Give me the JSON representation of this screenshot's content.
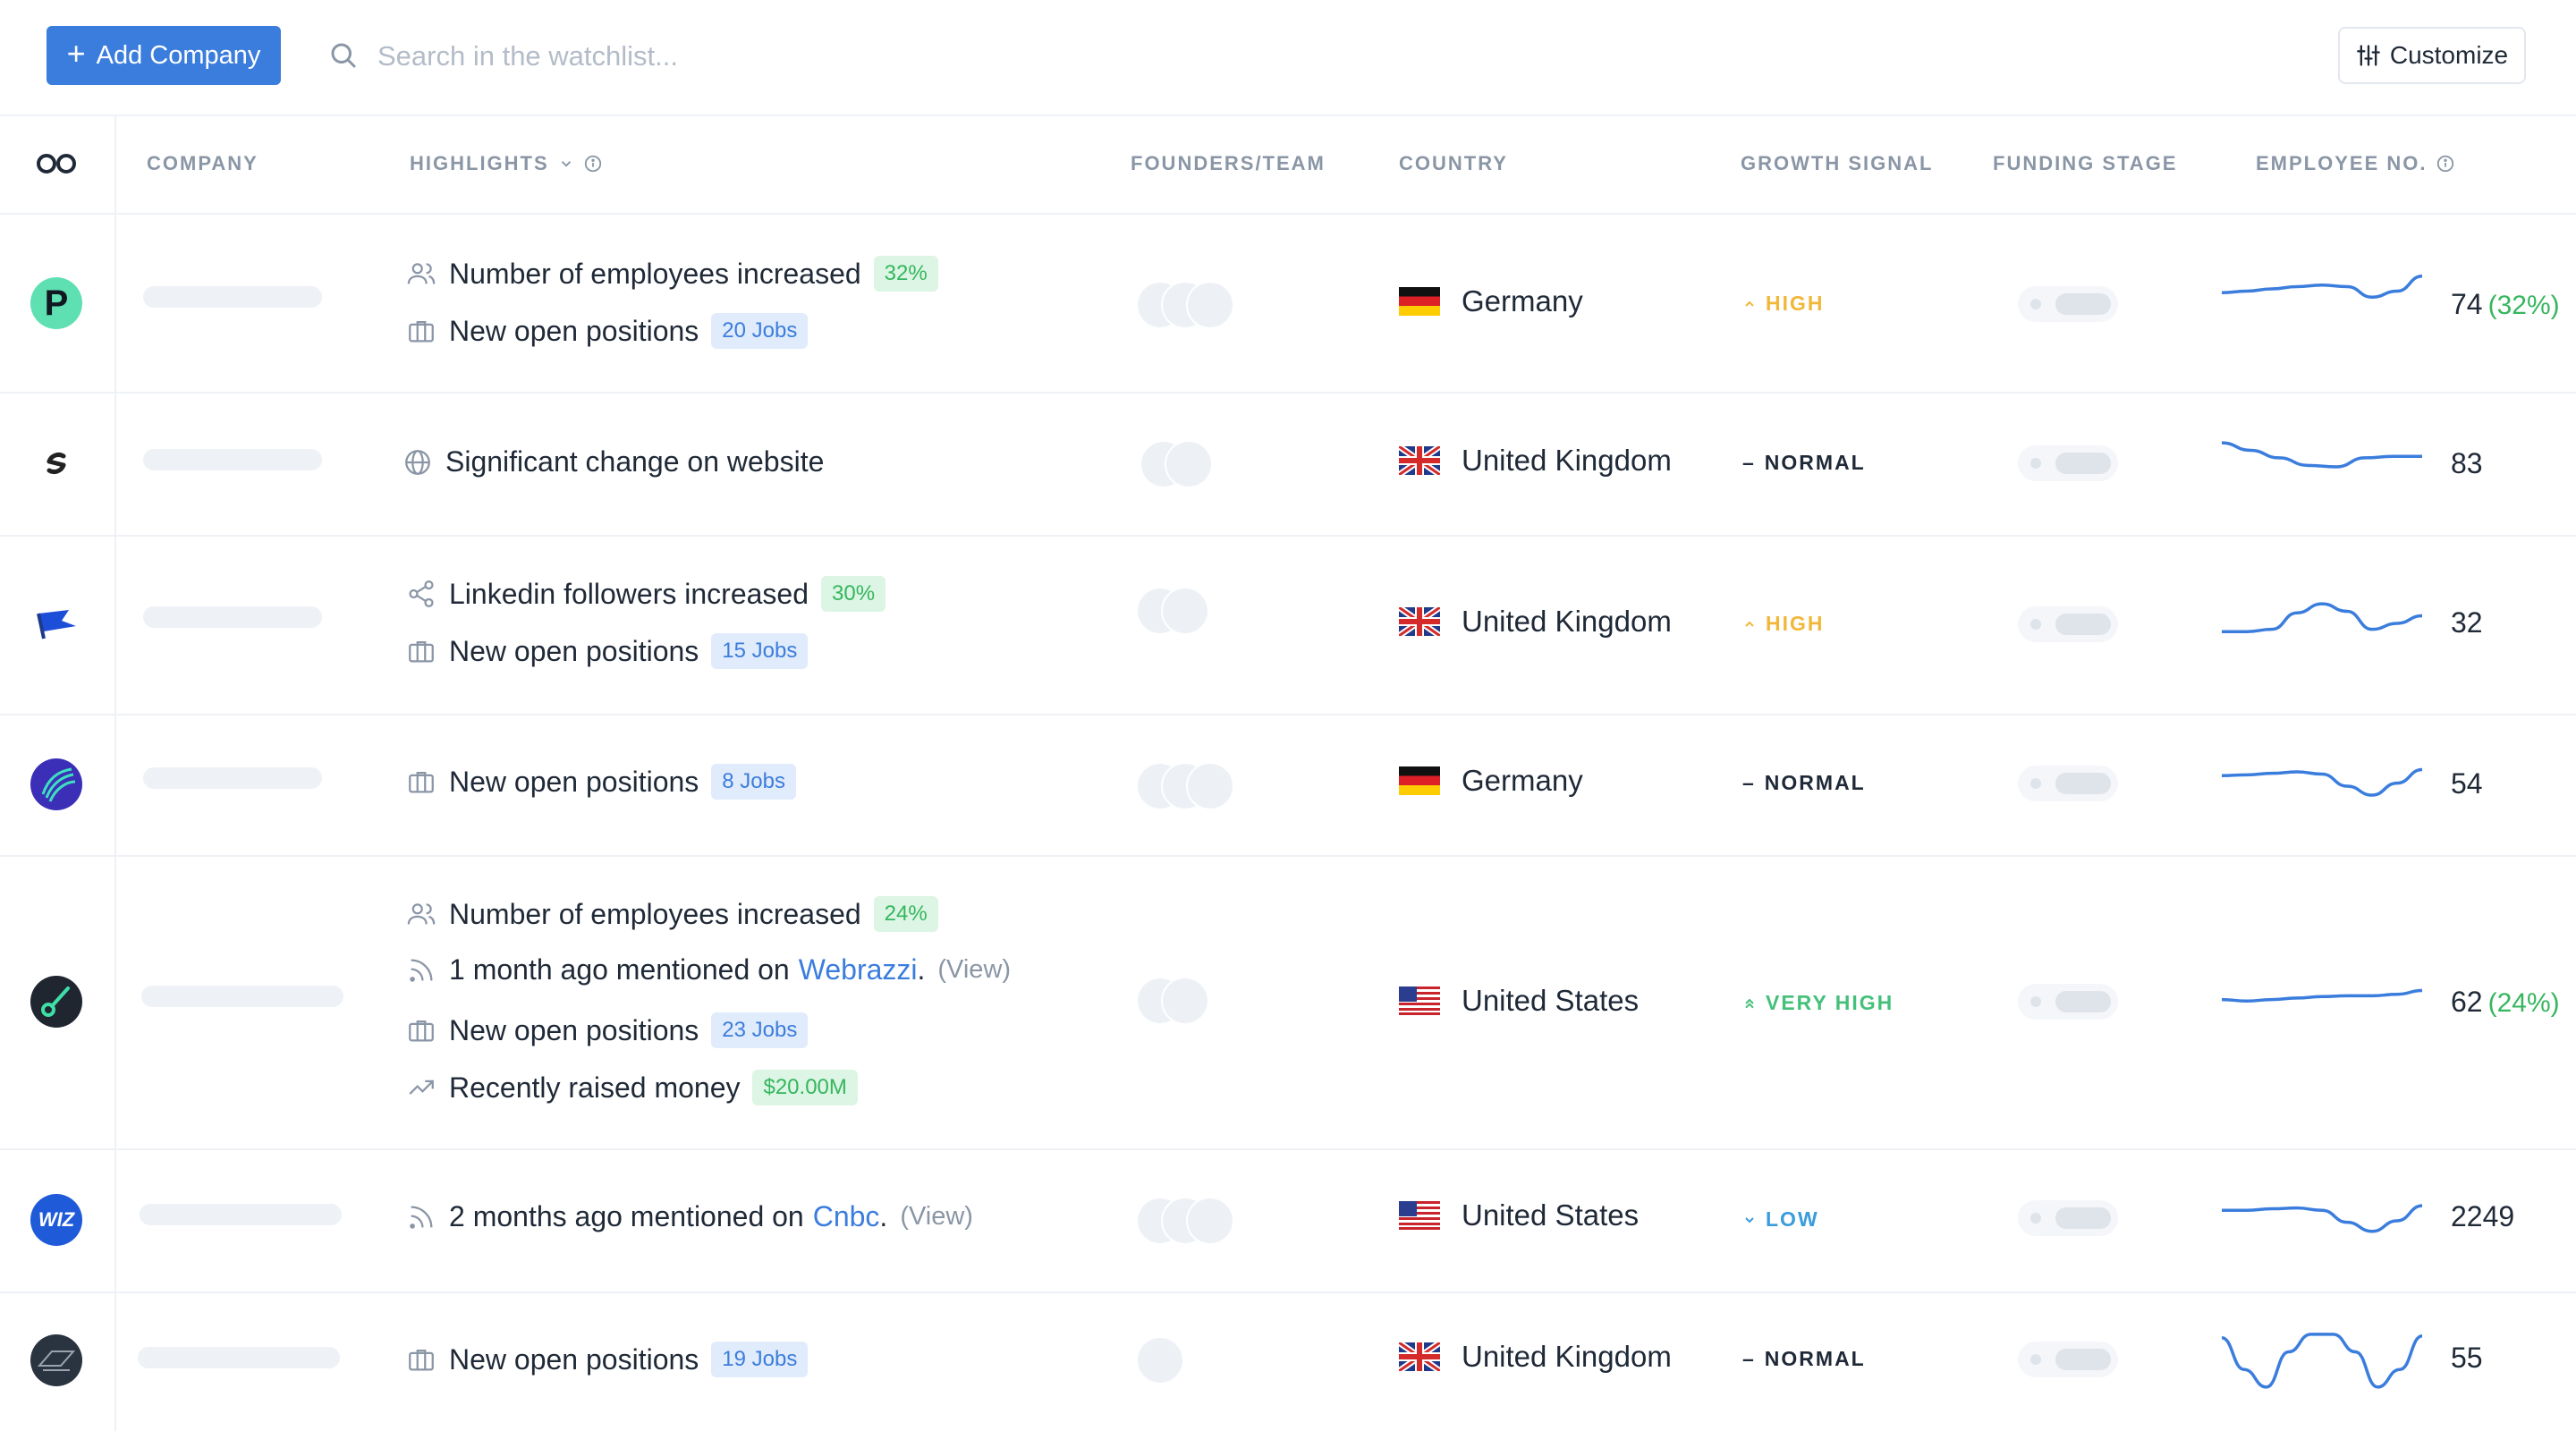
{
  "toolbar": {
    "add_company_label": "Add Company",
    "search_placeholder": "Search in the watchlist...",
    "customize_label": "Customize"
  },
  "columns": {
    "company": "COMPANY",
    "highlights": "HIGHLIGHTS",
    "founders": "FOUNDERS/TEAM",
    "country": "COUNTRY",
    "growth": "GROWTH SIGNAL",
    "funding": "FUNDING STAGE",
    "employees": "EMPLOYEE NO."
  },
  "colors": {
    "accent": "#3b7ddd",
    "high": "#f2b739",
    "very_high": "#44c07a",
    "low": "#3b9cdc",
    "green_badge": "#36b65e"
  },
  "rows": [
    {
      "logo_icon": "p-logo-icon",
      "highlights": [
        {
          "icon": "users-icon",
          "text": "Number of employees increased",
          "badge": "32%"
        },
        {
          "icon": "briefcase-icon",
          "text": "New open positions",
          "badge": "20 Jobs"
        }
      ],
      "country": "Germany",
      "signal": "HIGH",
      "employees": "74",
      "employees_change": "(32%)",
      "trend": [
        30,
        28,
        25,
        22,
        20,
        22,
        36,
        28,
        8
      ]
    },
    {
      "logo_icon": "swirl-logo-icon",
      "highlights": [
        {
          "icon": "globe-icon",
          "text": "Significant change on website"
        }
      ],
      "country": "United Kingdom",
      "signal": "NORMAL",
      "employees": "83",
      "trend": [
        18,
        28,
        38,
        48,
        50,
        38,
        36,
        36
      ]
    },
    {
      "logo_icon": "flag-logo-icon",
      "highlights": [
        {
          "icon": "share-icon",
          "text": "Linkedin followers increased",
          "badge": "30%"
        },
        {
          "icon": "briefcase-icon",
          "text": "New open positions",
          "badge": "15 Jobs"
        }
      ],
      "country": "United Kingdom",
      "signal": "HIGH",
      "employees": "32",
      "trend": [
        55,
        55,
        52,
        30,
        18,
        28,
        52,
        44,
        34
      ]
    },
    {
      "logo_icon": "globe-logo-icon",
      "highlights": [
        {
          "icon": "briefcase-icon",
          "text": "New open positions",
          "badge": "8 Jobs"
        }
      ],
      "country": "Germany",
      "signal": "NORMAL",
      "employees": "54",
      "trend": [
        30,
        29,
        27,
        25,
        28,
        44,
        56,
        40,
        22
      ]
    },
    {
      "logo_icon": "dial-logo-icon",
      "highlights": [
        {
          "icon": "users-icon",
          "text": "Number of employees increased",
          "badge": "24%"
        },
        {
          "icon": "rss-icon",
          "text": "1 month ago mentioned on",
          "link": "Webrazzi",
          "view": "(View)"
        },
        {
          "icon": "briefcase-icon",
          "text": "New open positions",
          "badge": "23 Jobs"
        },
        {
          "icon": "trend-icon",
          "text": "Recently raised money",
          "badge": "$20.00M"
        }
      ],
      "country": "United States",
      "signal": "VERY HIGH",
      "employees": "62",
      "employees_change": "(24%)",
      "trend": [
        40,
        42,
        40,
        38,
        36,
        35,
        35,
        33,
        28
      ]
    },
    {
      "logo_icon": "wiz-logo-icon",
      "logo_text": "WIZ",
      "highlights": [
        {
          "icon": "rss-icon",
          "text": "2 months ago mentioned on",
          "link": "Cnbc",
          "view": "(View)"
        }
      ],
      "country": "United States",
      "signal": "LOW",
      "employees": "2249",
      "trend": [
        30,
        30,
        28,
        27,
        30,
        46,
        58,
        44,
        24
      ]
    },
    {
      "logo_icon": "comat-logo-icon",
      "highlights": [
        {
          "icon": "briefcase-icon",
          "text": "New open positions",
          "badge": "19 Jobs"
        }
      ],
      "country": "United Kingdom",
      "signal": "NORMAL",
      "employees": "55",
      "trend": [
        14,
        50,
        70,
        30,
        10,
        10,
        30,
        70,
        50,
        12
      ]
    }
  ]
}
